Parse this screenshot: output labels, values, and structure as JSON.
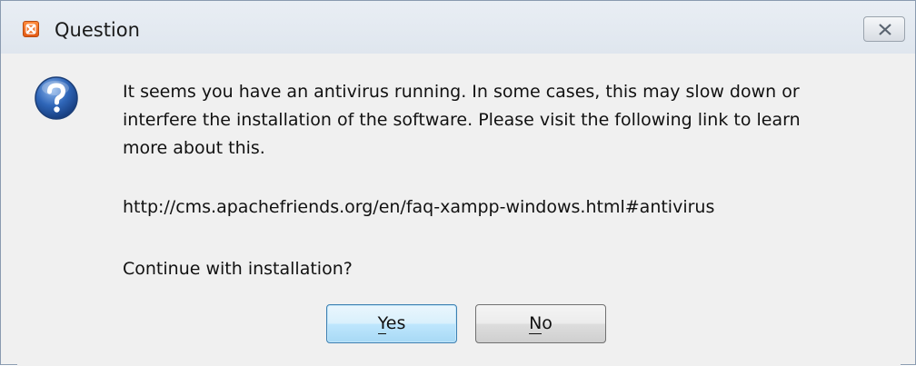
{
  "window": {
    "title": "Question",
    "close_icon": "close-icon",
    "app_icon": "xampp-icon"
  },
  "dialog": {
    "icon": "question-icon",
    "message_line1": "It seems you have an antivirus running. In some cases, this may slow down or",
    "message_line2": "interfere the installation of the software. Please visit the following link to learn",
    "message_line3": "more about this.",
    "link": "http://cms.apachefriends.org/en/faq-xampp-windows.html#antivirus",
    "prompt": "Continue with installation?"
  },
  "buttons": {
    "yes_label_mnemonic": "Y",
    "yes_label_rest": "es",
    "no_label_mnemonic": "N",
    "no_label_rest": "o"
  },
  "colors": {
    "app_icon": "#e35a14",
    "question_icon": "#2a5ca8",
    "default_button_border": "#3c7fb1"
  }
}
